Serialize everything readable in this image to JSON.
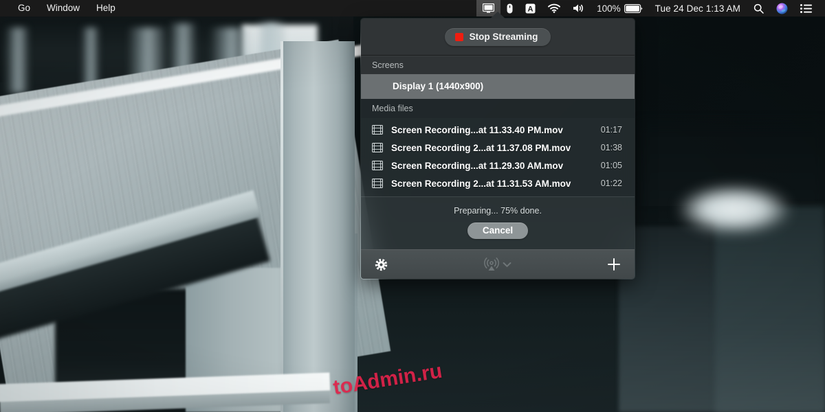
{
  "menubar": {
    "left_items": [
      {
        "label": "Go",
        "bold": false
      },
      {
        "label": "Window",
        "bold": false
      },
      {
        "label": "Help",
        "bold": false
      }
    ],
    "status_icons": [
      {
        "name": "screen-streaming-icon",
        "active": true
      },
      {
        "name": "mouse-icon",
        "active": false
      },
      {
        "name": "input-source-icon",
        "label": "A",
        "active": false
      },
      {
        "name": "wifi-icon",
        "active": false
      },
      {
        "name": "volume-icon",
        "active": false
      }
    ],
    "battery_percent": "100%",
    "clock": "Tue 24 Dec  1:13 AM",
    "right_icons": [
      {
        "name": "spotlight-search-icon"
      },
      {
        "name": "siri-icon"
      },
      {
        "name": "notification-center-icon"
      }
    ]
  },
  "panel": {
    "stop_button_label": "Stop Streaming",
    "screens_section_label": "Screens",
    "screens": [
      {
        "label": "Display 1 (1440x900)",
        "selected": true
      }
    ],
    "media_section_label": "Media files",
    "media_files": [
      {
        "name": "Screen Recording...at 11.33.40 PM.mov",
        "duration": "01:17"
      },
      {
        "name": "Screen Recording 2...at 11.37.08 PM.mov",
        "duration": "01:38"
      },
      {
        "name": "Screen Recording...at 11.29.30 AM.mov",
        "duration": "01:05"
      },
      {
        "name": "Screen Recording 2...at 11.31.53 AM.mov",
        "duration": "01:22"
      }
    ],
    "progress_text": "Preparing... 75% done.",
    "progress_percent": 75,
    "cancel_button_label": "Cancel",
    "toolbar": {
      "settings_icon": "gear-icon",
      "broadcast_icon": "broadcast-icon",
      "broadcast_chevron_icon": "chevron-down-icon",
      "add_icon": "plus-icon"
    }
  },
  "watermark": {
    "text": "toAdmin.ru"
  },
  "colors": {
    "record_dot": "#f01d10",
    "panel_header_bg": "#303436",
    "selected_row_bg": "#6b7072",
    "watermark": "#e0234a",
    "menubar_bg": "#1a1a1a"
  }
}
